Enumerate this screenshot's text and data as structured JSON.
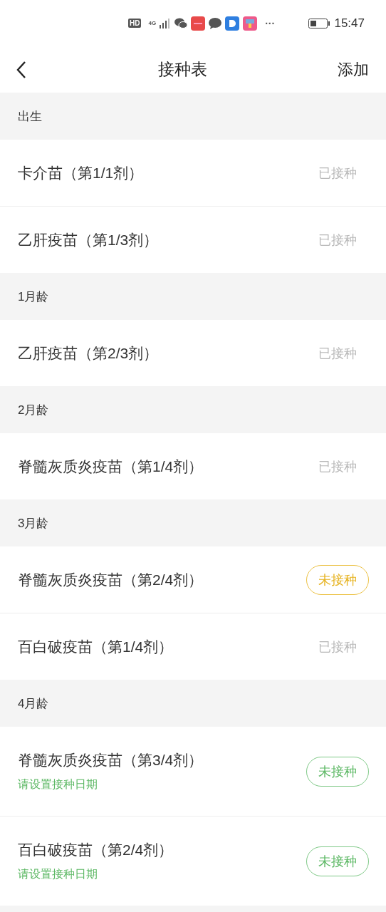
{
  "status_bar": {
    "hd": "HD",
    "network": "4G",
    "more": "···",
    "time": "15:47"
  },
  "nav": {
    "title": "接种表",
    "action": "添加"
  },
  "sections": [
    {
      "title": "出生",
      "items": [
        {
          "name": "卡介苗（第1/1剂）",
          "kind": "done",
          "label": "已接种"
        },
        {
          "name": "乙肝疫苗（第1/3剂）",
          "kind": "done",
          "label": "已接种"
        }
      ]
    },
    {
      "title": "1月龄",
      "items": [
        {
          "name": "乙肝疫苗（第2/3剂）",
          "kind": "done",
          "label": "已接种"
        }
      ]
    },
    {
      "title": "2月龄",
      "items": [
        {
          "name": "脊髓灰质炎疫苗（第1/4剂）",
          "kind": "done",
          "label": "已接种"
        }
      ]
    },
    {
      "title": "3月龄",
      "items": [
        {
          "name": "脊髓灰质炎疫苗（第2/4剂）",
          "kind": "due",
          "label": "未接种"
        },
        {
          "name": "百白破疫苗（第1/4剂）",
          "kind": "done",
          "label": "已接种"
        }
      ]
    },
    {
      "title": "4月龄",
      "items": [
        {
          "name": "脊髓灰质炎疫苗（第3/4剂）",
          "kind": "pending",
          "label": "未接种",
          "note": "请设置接种日期"
        },
        {
          "name": "百白破疫苗（第2/4剂）",
          "kind": "pending",
          "label": "未接种",
          "note": "请设置接种日期"
        }
      ]
    }
  ]
}
